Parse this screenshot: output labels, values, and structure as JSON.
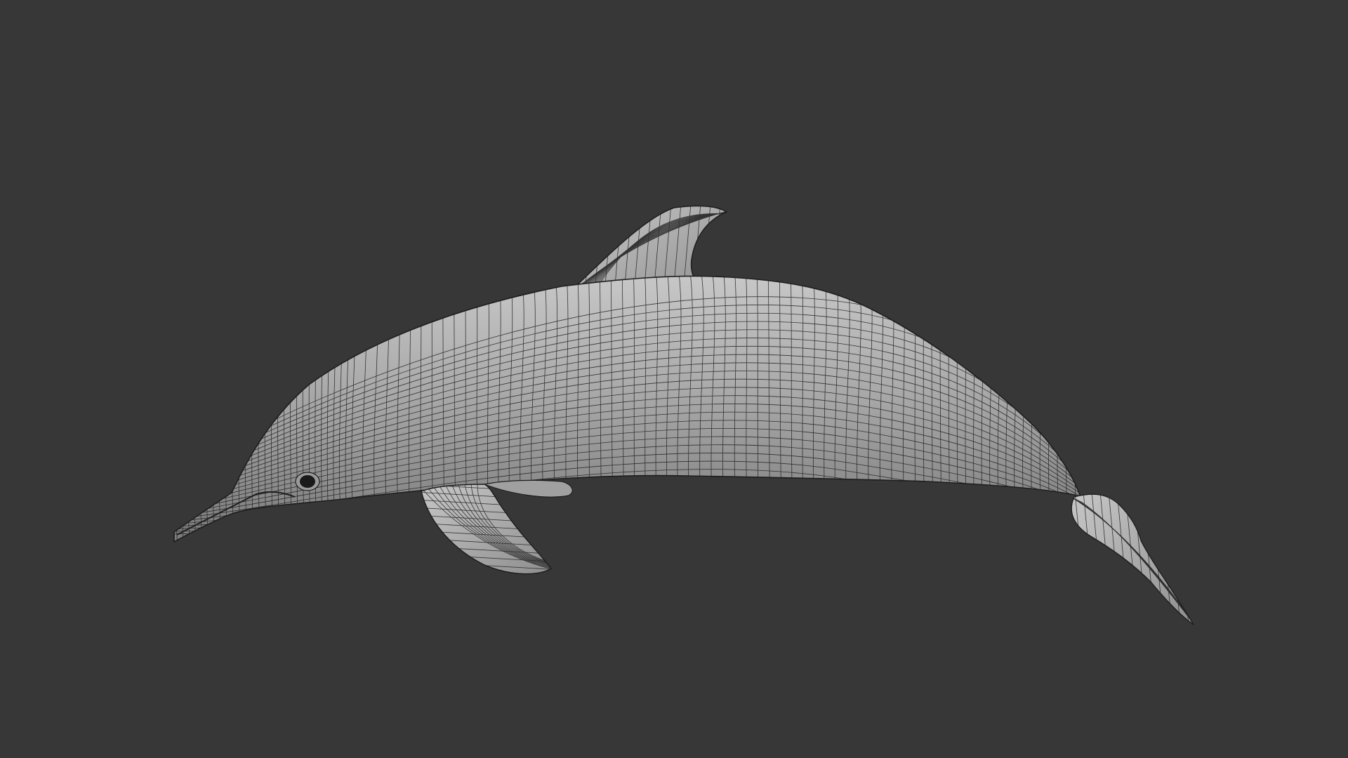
{
  "viewport": {
    "background_color": "#373737"
  },
  "model": {
    "subject": "dolphin",
    "display_mode": "wireframe-on-shaded",
    "surface_color": "#a8a8a8",
    "surface_highlight_color": "#c7c7c7",
    "surface_shadow_color": "#7a7a7a",
    "wire_color": "#1e1e1e",
    "eye_color": "#1a1a1a"
  }
}
